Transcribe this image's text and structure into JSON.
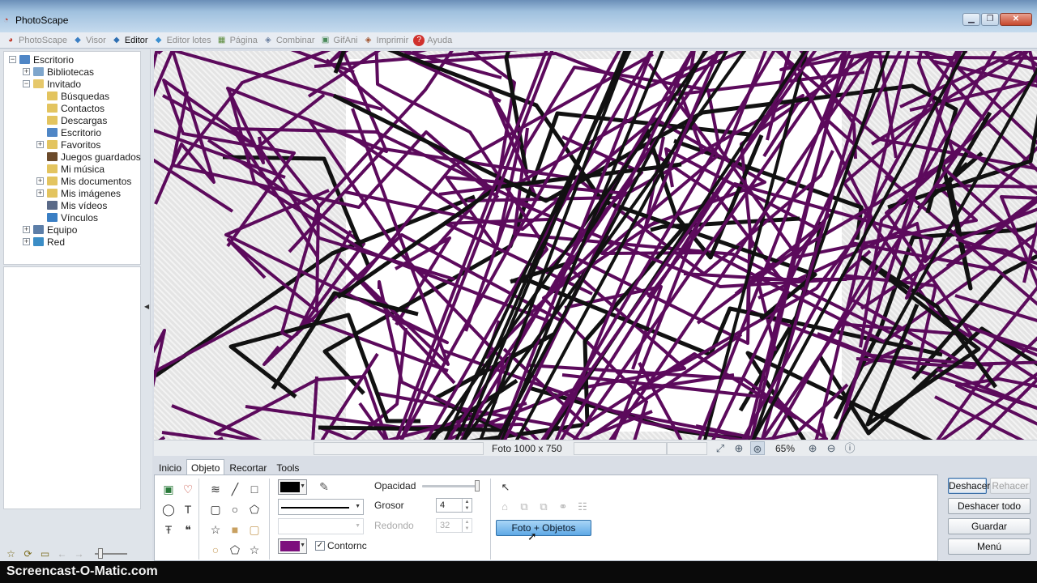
{
  "window": {
    "title": "PhotoScape",
    "minimize": "0",
    "maximize": "1",
    "close": "r"
  },
  "menu_tabs": [
    {
      "label": "PhotoScape",
      "active": false
    },
    {
      "label": "Visor",
      "active": false
    },
    {
      "label": "Editor",
      "active": true
    },
    {
      "label": "Editor lotes",
      "active": false
    },
    {
      "label": "Página",
      "active": false
    },
    {
      "label": "Combinar",
      "active": false
    },
    {
      "label": "GifAni",
      "active": false
    },
    {
      "label": "Imprimir",
      "active": false
    },
    {
      "label": "Ayuda",
      "active": false
    }
  ],
  "tree": {
    "root": "Escritorio",
    "libraries": "Bibliotecas",
    "user": "Invitado",
    "user_children": [
      "Búsquedas",
      "Contactos",
      "Descargas",
      "Escritorio",
      "Favoritos",
      "Juegos guardados",
      "Mi música",
      "Mis documentos",
      "Mis imágenes",
      "Mis vídeos",
      "Vínculos"
    ],
    "computer": "Equipo",
    "network": "Red"
  },
  "status": {
    "image_size": "Foto 1000 x 750",
    "zoom": "65%"
  },
  "tool_tabs": [
    "Inicio",
    "Objeto",
    "Recortar",
    "Tools"
  ],
  "object_tab": {
    "opacity_label": "Opacidad",
    "thickness_label": "Grosor",
    "thickness_value": "4",
    "rounded_label": "Redondo",
    "rounded_value": "32",
    "outline_label": "Contornc",
    "outline_checked": true,
    "photo_objects_button": "Foto + Objetos",
    "line_color": "#000000",
    "fill_color": "#7d0f7d",
    "opacity_percent": 100
  },
  "right_buttons": {
    "undo": "Deshacer",
    "redo": "Rehacer",
    "undo_all": "Deshacer todo",
    "save": "Guardar",
    "menu": "Menú"
  },
  "watermark": "Screencast-O-Matic.com",
  "colors": {
    "scribble": "#5c0a5c",
    "scribble_dark": "#111111"
  }
}
